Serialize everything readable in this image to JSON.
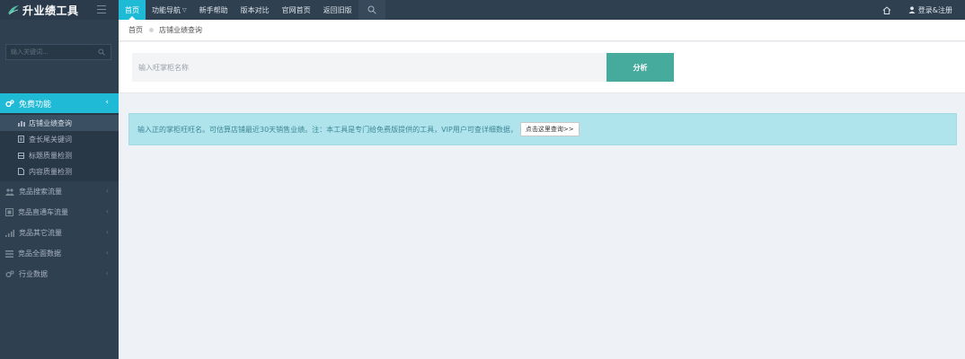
{
  "brand": {
    "name": "升业绩工具"
  },
  "sidebar": {
    "search_placeholder": "输入关键词...",
    "active_menu": {
      "label": "免费功能",
      "icon": "gears-icon"
    },
    "submenu": [
      {
        "label": "店铺业绩查询",
        "icon": "bar-chart-icon",
        "current": true
      },
      {
        "label": "查长尾关键词",
        "icon": "document-icon"
      },
      {
        "label": "标题质量检测",
        "icon": "grid-icon"
      },
      {
        "label": "内容质量检测",
        "icon": "file-icon"
      }
    ],
    "menu": [
      {
        "label": "竞品搜索流量",
        "icon": "users-icon"
      },
      {
        "label": "竞品直通车流量",
        "icon": "car-icon"
      },
      {
        "label": "竞品其它流量",
        "icon": "signal-icon"
      },
      {
        "label": "竞品全面数据",
        "icon": "list-icon"
      },
      {
        "label": "行业数据",
        "icon": "gear-icon"
      }
    ]
  },
  "topnav": {
    "items": [
      {
        "label": "首页",
        "active": true
      },
      {
        "label": "功能导航",
        "dropdown": true
      },
      {
        "label": "新手帮助"
      },
      {
        "label": "版本对比"
      },
      {
        "label": "官网首页"
      },
      {
        "label": "返回旧版"
      }
    ],
    "login_label": "登录&注册"
  },
  "breadcrumb": {
    "home": "首页",
    "current": "店铺业绩查询"
  },
  "search": {
    "placeholder": "输入旺掌柜名称",
    "value": "",
    "button_label": "分析"
  },
  "alert": {
    "text": "输入正的掌柜旺旺名。可估算店铺最近30天销售业绩。注：本工具是专门给免费版提供的工具，VIP用户可查详细数据，",
    "button_label": "点击这里查询>>"
  },
  "colors": {
    "accent": "#1fbad6",
    "sidebar": "#2f4050",
    "button": "#46ab9d",
    "alert_bg": "#b0e4ec"
  }
}
